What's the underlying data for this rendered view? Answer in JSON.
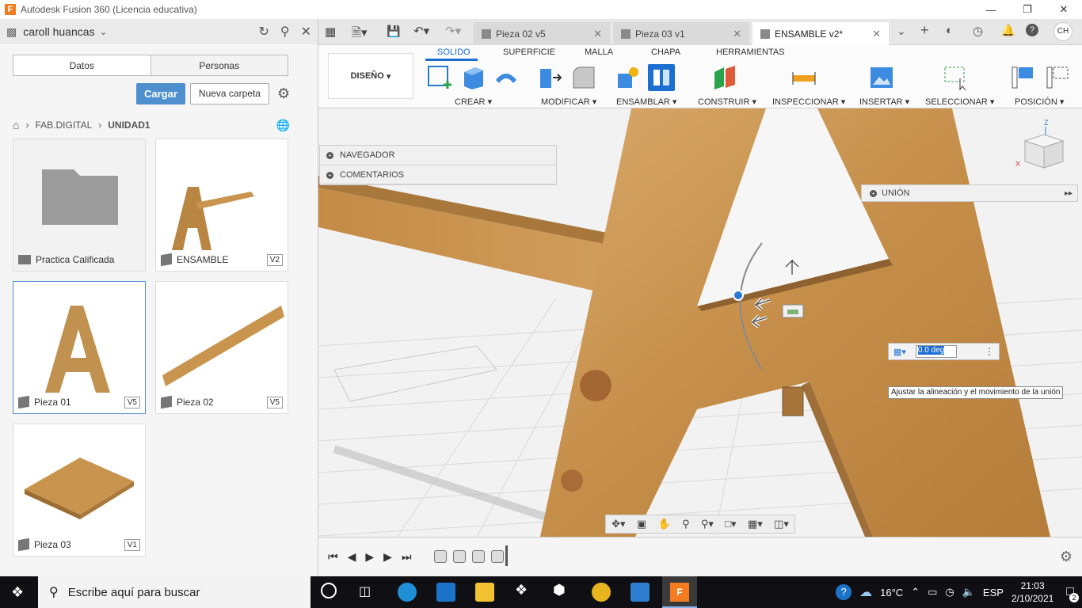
{
  "window": {
    "title": "Autodesk Fusion 360 (Licencia educativa)",
    "app_icon": "F"
  },
  "left_panel": {
    "user": "caroll huancas",
    "tabs": [
      "Datos",
      "Personas"
    ],
    "upload_button": "Cargar",
    "new_folder_button": "Nueva carpeta",
    "breadcrumb": [
      "FAB.DIGITAL",
      "UNIDAD1"
    ],
    "items": [
      {
        "name": "Practica Calificada",
        "type": "folder",
        "version": ""
      },
      {
        "name": "ENSAMBLE",
        "type": "assembly",
        "version": "V2"
      },
      {
        "name": "Pieza 01",
        "type": "part",
        "version": "V5"
      },
      {
        "name": "Pieza 02",
        "type": "part",
        "version": "V5"
      },
      {
        "name": "Pieza 03",
        "type": "part",
        "version": "V1"
      }
    ]
  },
  "doc_tabs": [
    "Pieza 02 v5",
    "Pieza 03 v1",
    "ENSAMBLE v2*"
  ],
  "user_initials": "CH",
  "ribbon": {
    "workspace": "DISEÑO",
    "tabs": [
      "SOLIDO",
      "SUPERFICIE",
      "MALLA",
      "CHAPA",
      "HERRAMIENTAS"
    ],
    "groups": [
      "CREAR",
      "MODIFICAR",
      "ENSAMBLAR",
      "CONSTRUIR",
      "INSPECCIONAR",
      "INSERTAR",
      "SELECCIONAR",
      "POSICIÓN"
    ]
  },
  "browser_panel": [
    "NAVEGADOR",
    "COMENTARIOS"
  ],
  "union_panel": "UNIÓN",
  "angle_value": "0.0 deg",
  "tooltip": "Ajustar la alineación y el movimiento de la unión",
  "viewcube": {
    "axis_z": "Z",
    "axis_x": "X"
  },
  "taskbar": {
    "search_placeholder": "Escribe aquí para buscar",
    "temperature": "16°C",
    "language": "ESP",
    "time": "21:03",
    "date": "2/10/2021",
    "notifications": "2"
  },
  "colors": {
    "accent": "#1b6fd1",
    "wood": "#c9944e",
    "fusion_orange": "#f37c20"
  }
}
